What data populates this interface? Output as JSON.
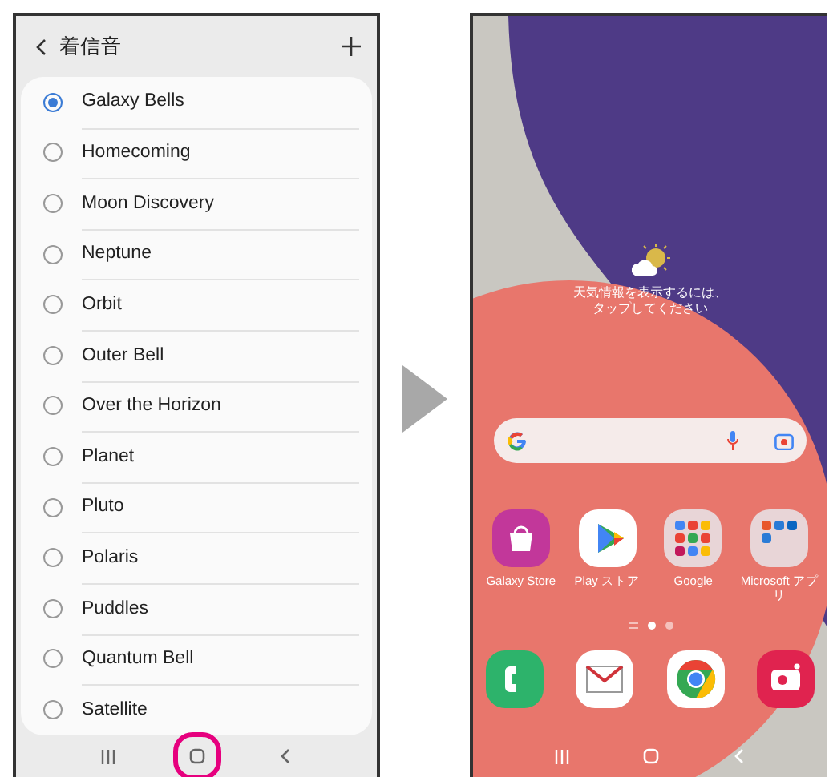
{
  "ringtone_screen": {
    "title": "着信音",
    "items": [
      {
        "label": "Galaxy Bells",
        "selected": true
      },
      {
        "label": "Homecoming",
        "selected": false
      },
      {
        "label": "Moon Discovery",
        "selected": false
      },
      {
        "label": "Neptune",
        "selected": false
      },
      {
        "label": "Orbit",
        "selected": false
      },
      {
        "label": "Outer Bell",
        "selected": false
      },
      {
        "label": "Over the Horizon",
        "selected": false
      },
      {
        "label": "Planet",
        "selected": false
      },
      {
        "label": "Pluto",
        "selected": false
      },
      {
        "label": "Polaris",
        "selected": false
      },
      {
        "label": "Puddles",
        "selected": false
      },
      {
        "label": "Quantum Bell",
        "selected": false
      },
      {
        "label": "Satellite",
        "selected": false
      }
    ],
    "nav_buttons": [
      {
        "kind": "recents",
        "highlighted": false
      },
      {
        "kind": "home",
        "highlighted": true
      },
      {
        "kind": "back",
        "highlighted": false
      }
    ]
  },
  "home_screen": {
    "weather_hint": [
      "天気情報を表示するには、",
      "タップしてください"
    ],
    "apps": [
      {
        "kind": "store",
        "label": "Galaxy Store"
      },
      {
        "kind": "play",
        "label": "Play ストア"
      },
      {
        "kind": "folder-google",
        "label": "Google"
      },
      {
        "kind": "folder-microsoft",
        "label": "Microsoft アプリ"
      }
    ],
    "page_indicators": [
      {
        "kind": "lines",
        "selected": false
      },
      {
        "kind": "dot",
        "selected": true
      },
      {
        "kind": "dot",
        "selected": false
      }
    ],
    "dock": [
      {
        "kind": "phone"
      },
      {
        "kind": "mail"
      },
      {
        "kind": "chrome"
      },
      {
        "kind": "camera"
      }
    ],
    "nav_buttons": [
      {
        "kind": "recents",
        "highlighted": false
      },
      {
        "kind": "home",
        "highlighted": false
      },
      {
        "kind": "back",
        "highlighted": false
      }
    ]
  }
}
